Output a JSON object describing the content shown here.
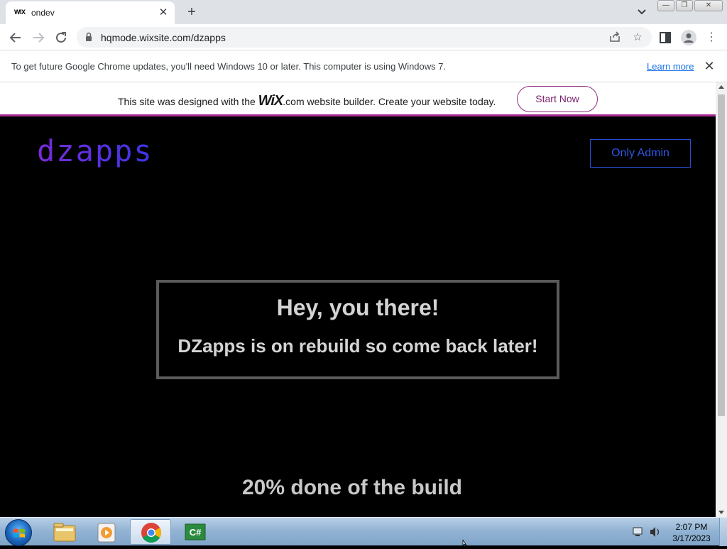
{
  "browser": {
    "tab": {
      "favicon_text": "WIX",
      "title": "ondev"
    },
    "url": "hqmode.wixsite.com/dzapps",
    "infobar": {
      "message": "To get future Google Chrome updates, you'll need Windows 10 or later. This computer is using Windows 7.",
      "link": "Learn more"
    },
    "icons": [
      "back-icon",
      "forward-icon",
      "reload-icon",
      "lock-icon",
      "share-icon",
      "star-icon",
      "side-panel-icon",
      "profile-icon",
      "menu-icon",
      "tab-search-icon"
    ]
  },
  "wix_banner": {
    "prefix": "This site was designed with the ",
    "logo": "WiX",
    "dotcom": ".com",
    "suffix": " website builder. Create your website today.",
    "button": "Start Now"
  },
  "site": {
    "logo": "dzapps",
    "admin_button": "Only Admin",
    "notice_title": "Hey, you there!",
    "notice_body": "DZapps is on rebuild so come back later!",
    "progress": "20% done of the build"
  },
  "taskbar": {
    "time": "2:07 PM",
    "date": "3/17/2023",
    "apps": [
      "file-explorer-icon",
      "media-player-icon",
      "chrome-icon",
      "csharp-app-icon"
    ]
  },
  "colors": {
    "page_bg": "#000000",
    "logo_gradient_start": "#7a2ad8",
    "logo_gradient_end": "#3a36e6",
    "admin_blue": "#3058e8",
    "wix_accent": "#a82c94",
    "notice_border": "#5a5a5a"
  }
}
